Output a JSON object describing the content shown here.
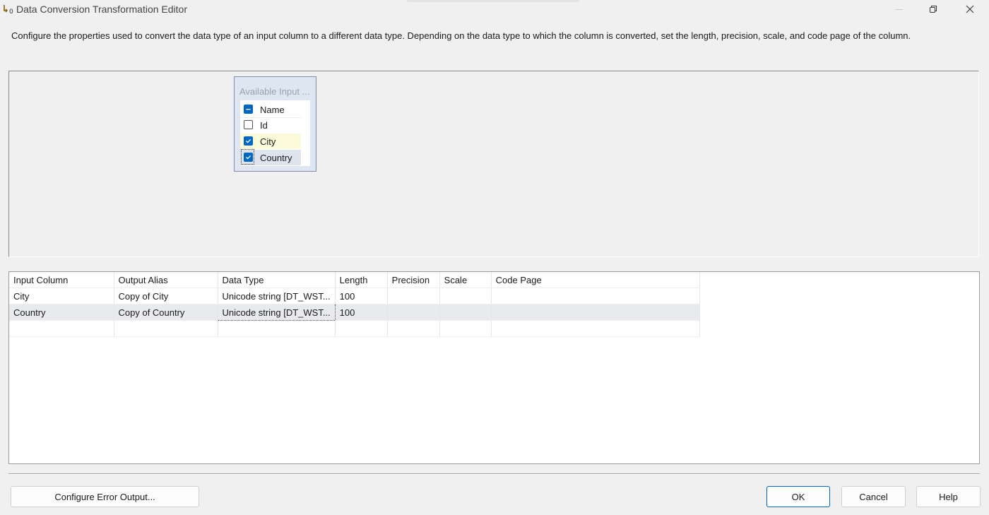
{
  "window": {
    "title": "Data Conversion Transformation Editor"
  },
  "description": "Configure the properties used to convert the data type of an input column to a different data type. Depending on the data type to which the column is converted, set the length, precision, scale, and code page of the column.",
  "available_inputs": {
    "title": "Available Input ...",
    "items": [
      {
        "label": "Name",
        "state": "indeterminate"
      },
      {
        "label": "Id",
        "state": "unchecked"
      },
      {
        "label": "City",
        "state": "checked"
      },
      {
        "label": "Country",
        "state": "checked"
      }
    ]
  },
  "grid": {
    "columns": [
      "Input Column",
      "Output Alias",
      "Data Type",
      "Length",
      "Precision",
      "Scale",
      "Code Page"
    ],
    "rows": [
      [
        "City",
        "Copy of City",
        "Unicode string [DT_WST...",
        "100",
        "",
        "",
        ""
      ],
      [
        "Country",
        "Copy of Country",
        "Unicode string [DT_WST...",
        "100",
        "",
        "",
        ""
      ]
    ]
  },
  "buttons": {
    "configure_error_output": "Configure Error Output...",
    "ok": "OK",
    "cancel": "Cancel",
    "help": "Help"
  },
  "colors": {
    "accent": "#0067c0",
    "selected_row": "#e8eaed",
    "city_highlight": "#fbfbdc"
  }
}
